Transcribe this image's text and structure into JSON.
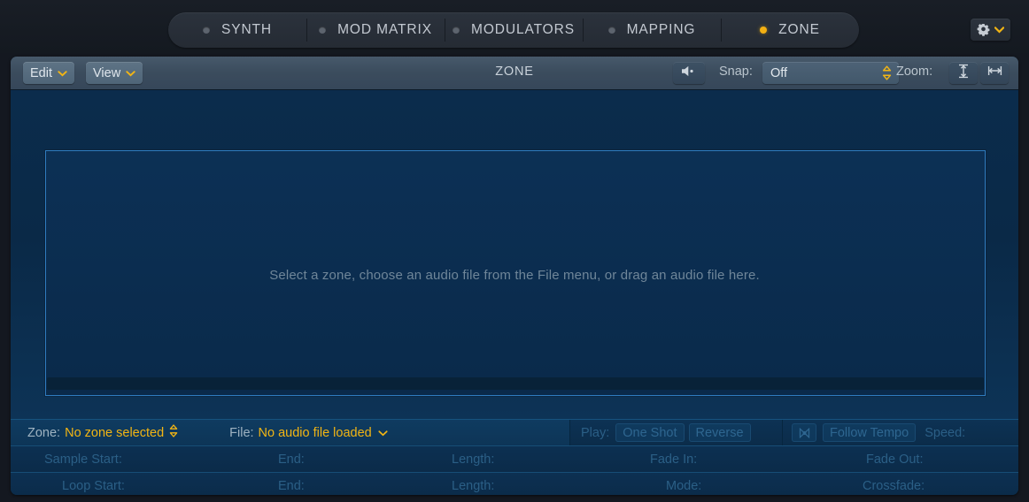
{
  "tabs": [
    {
      "label": "SYNTH",
      "active": false,
      "name": "tab-synth"
    },
    {
      "label": "MOD MATRIX",
      "active": false,
      "name": "tab-mod-matrix"
    },
    {
      "label": "MODULATORS",
      "active": false,
      "name": "tab-modulators"
    },
    {
      "label": "MAPPING",
      "active": false,
      "name": "tab-mapping"
    },
    {
      "label": "ZONE",
      "active": true,
      "name": "tab-zone"
    }
  ],
  "settings_button": {
    "gear_icon": "gear-icon",
    "chevron_icon": "chevron-down-icon"
  },
  "toolbar": {
    "edit_label": "Edit",
    "view_label": "View",
    "title": "ZONE",
    "speaker_icon": "speaker-icon",
    "snap_label": "Snap:",
    "snap_value": "Off",
    "zoom_label": "Zoom:",
    "zoom_vertical_icon": "zoom-fit-vertical-icon",
    "zoom_horizontal_icon": "zoom-fit-horizontal-icon"
  },
  "editor": {
    "hint": "Select a zone, choose an audio file from the File menu, or drag an audio file here."
  },
  "info": {
    "zone_label": "Zone:",
    "zone_value": "No zone selected",
    "file_label": "File:",
    "file_value": "No audio file loaded",
    "play_label": "Play:",
    "one_shot_label": "One Shot",
    "reverse_label": "Reverse",
    "tempo_icon": "flex-tempo-icon",
    "follow_tempo_label": "Follow Tempo",
    "speed_label": "Speed:"
  },
  "params": {
    "sample_start": "Sample Start:",
    "sample_end": "End:",
    "sample_length": "Length:",
    "fade_in": "Fade In:",
    "fade_out": "Fade Out:",
    "loop_start": "Loop Start:",
    "loop_end": "End:",
    "loop_length": "Length:",
    "mode": "Mode:",
    "crossfade": "Crossfade:"
  },
  "colors": {
    "accent": "#f2b514",
    "tab_active_dot": "#f3b013",
    "zone_border": "#2f7cc0",
    "editor_bg": "#0a2947"
  }
}
